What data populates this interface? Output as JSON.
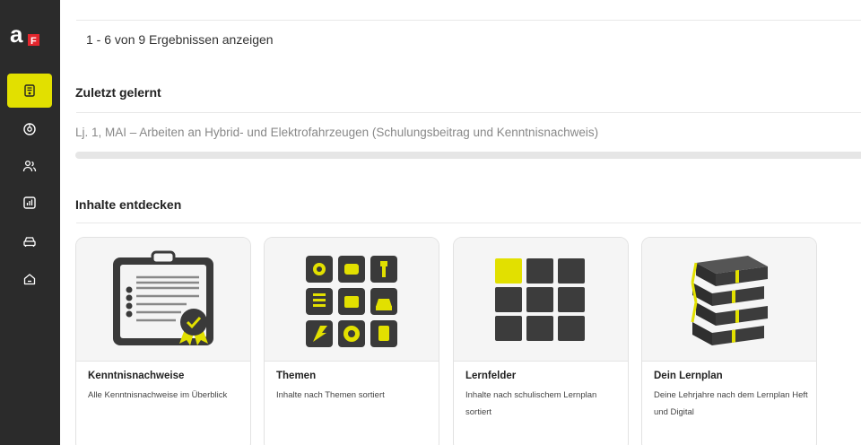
{
  "results": {
    "text": "1 - 6 von 9 Ergebnissen anzeigen"
  },
  "recent": {
    "title": "Zuletzt gelernt",
    "item": "Lj. 1, MAI – Arbeiten an Hybrid- und Elektrofahrzeugen (Schulungsbeitrag und Kenntnisnachweis)",
    "progress": 0
  },
  "discover": {
    "title": "Inhalte entdecken",
    "cards": [
      {
        "title": "Kenntnisnachweise",
        "desc": "Alle Kenntnisnachweise im Überblick",
        "icon": "certificate-clipboard-icon"
      },
      {
        "title": "Themen",
        "desc": "Inhalte nach Themen sortiert",
        "icon": "topics-grid-icon"
      },
      {
        "title": "Lernfelder",
        "desc": "Inhalte nach schulischem Lernplan sortiert",
        "icon": "learning-fields-grid-icon"
      },
      {
        "title": "Dein Lernplan",
        "desc": "Deine Lehrjahre nach dem Lernplan Heft und Digital",
        "icon": "book-stack-icon"
      }
    ]
  },
  "sidebar": {
    "logo_text": "a",
    "logo_badge": "F",
    "items": [
      {
        "icon": "certificate-icon",
        "active": true
      },
      {
        "icon": "compass-icon",
        "active": false
      },
      {
        "icon": "users-icon",
        "active": false
      },
      {
        "icon": "chart-icon",
        "active": false
      },
      {
        "icon": "car-icon",
        "active": false
      },
      {
        "icon": "home-icon",
        "active": false
      }
    ]
  },
  "colors": {
    "accent": "#e2e000",
    "sidebar": "#2b2b2b",
    "dark_tile": "#3c3c3c"
  }
}
